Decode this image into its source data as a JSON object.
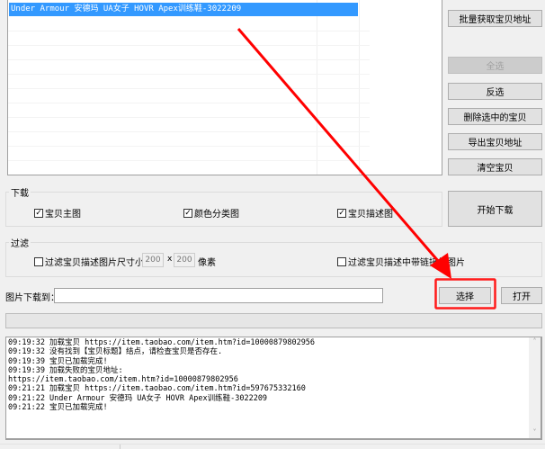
{
  "list": {
    "selected_item": "Under Armour 安德玛 UA女子 HOVR Apex训练鞋-3022209"
  },
  "buttons": {
    "batch_get": "批量获取宝贝地址",
    "select_all": "全选",
    "invert": "反选",
    "delete_selected": "删除选中的宝贝",
    "export": "导出宝贝地址",
    "clear": "清空宝贝",
    "start_download": "开始下载",
    "choose": "选择",
    "open": "打开"
  },
  "download": {
    "title": "下载",
    "options": [
      {
        "label": "宝贝主图",
        "checked": true
      },
      {
        "label": "颜色分类图",
        "checked": true
      },
      {
        "label": "宝贝描述图",
        "checked": true
      }
    ]
  },
  "filter": {
    "title": "过滤",
    "size_label": "过滤宝贝描述图片尺寸小于：",
    "width": "200",
    "x": "x",
    "height": "200",
    "unit": "像素",
    "size_checked": false,
    "link_label": "过滤宝贝描述中带链接的图片",
    "link_checked": false
  },
  "path": {
    "label": "图片下载到：",
    "value": ""
  },
  "progress": 0,
  "log": [
    "09:19:32 加载宝贝 https://item.taobao.com/item.htm?id=10000879802956",
    "09:19:32 没有找到【宝贝标题】结点，请检查宝贝是否存在.",
    "09:19:39 宝贝已加载完成!",
    "09:19:39 加载失败的宝贝地址:",
    "https://item.taobao.com/item.htm?id=10000879802956",
    "09:21:21 加载宝贝 https://item.taobao.com/item.htm?id=597675332160",
    "09:21:22 Under Armour 安德玛 UA女子 HOVR Apex训练鞋-3022209",
    "09:21:22 宝贝已加载完成!"
  ],
  "annotation_color": "#ff0000"
}
